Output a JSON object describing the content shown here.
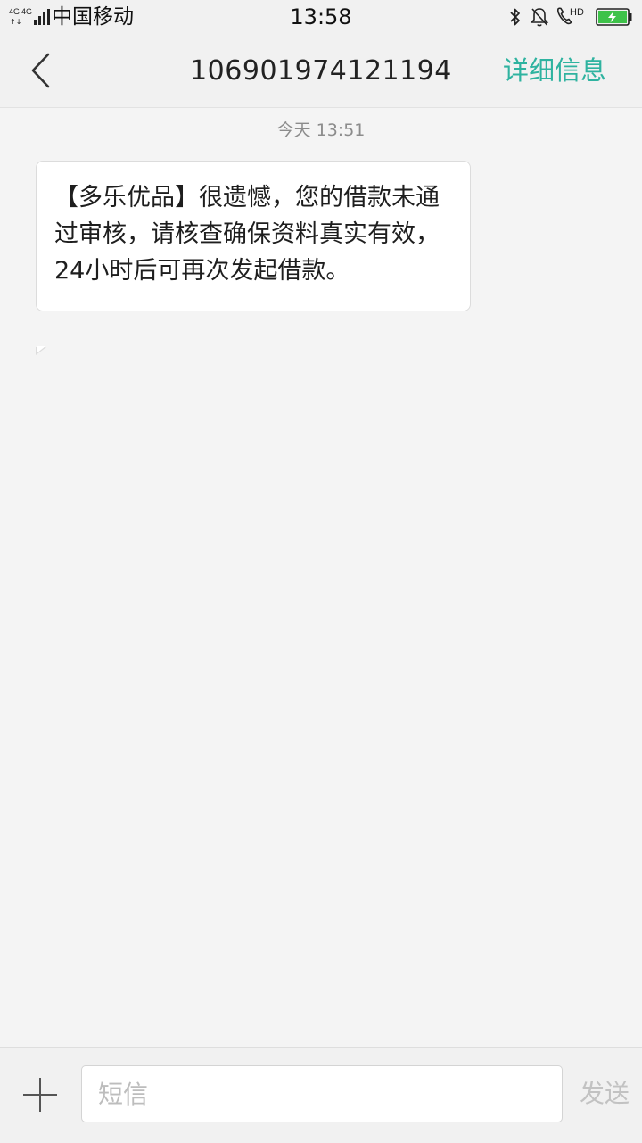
{
  "status_bar": {
    "network_1": "4G",
    "network_2": "4G",
    "carrier": "中国移动",
    "time": "13:58",
    "hd_label": "HD",
    "icons": [
      "bluetooth-icon",
      "mute-bell-icon",
      "hd-call-icon",
      "battery-charging-icon"
    ],
    "battery_color": "#3ec24a"
  },
  "header": {
    "title": "106901974121194",
    "detail_label": "详细信息",
    "accent_color": "#2fb3a0"
  },
  "conversation": {
    "timestamp": "今天  13:51",
    "messages": [
      {
        "direction": "incoming",
        "text": "【多乐优品】很遗憾，您的借款未通过审核，请核查确保资料真实有效，24小时后可再次发起借款。"
      }
    ]
  },
  "compose": {
    "placeholder": "短信",
    "send_label": "发送"
  }
}
